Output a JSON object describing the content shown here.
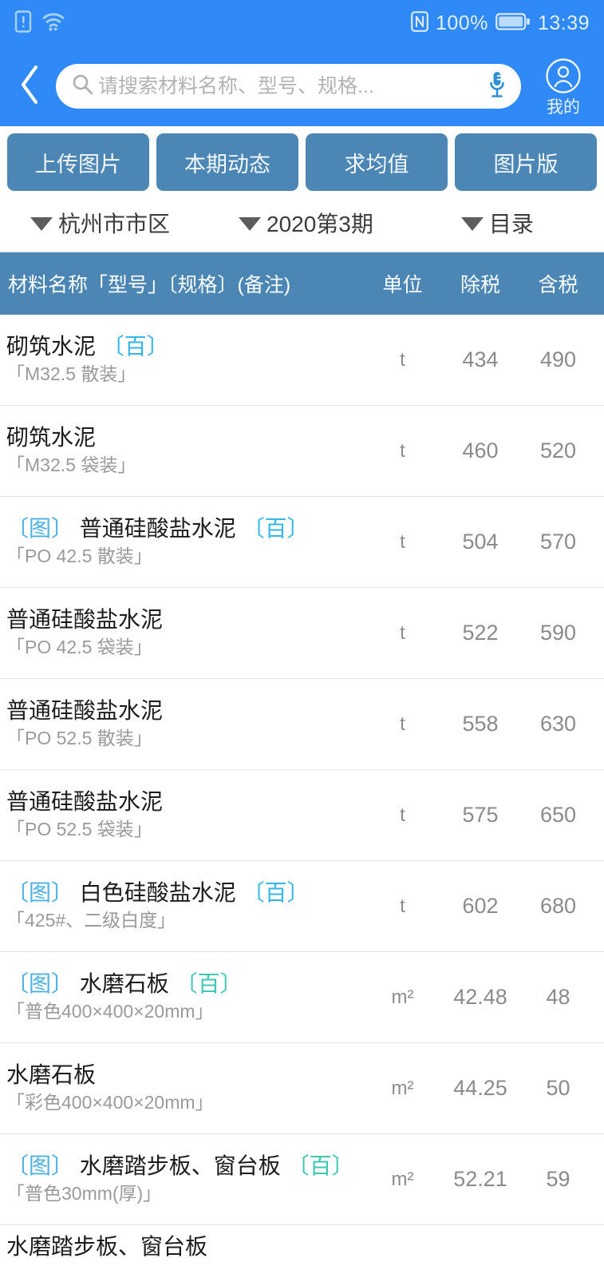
{
  "status_bar": {
    "icons_left": [
      "sim-alert-icon",
      "wifi-icon"
    ],
    "nfc_icon": "nfc-icon",
    "battery_percent": "100%",
    "battery_icon": "battery-full-icon",
    "time": "13:39"
  },
  "header": {
    "back_icon": "back-chevron-icon",
    "search": {
      "icon": "search-icon",
      "placeholder": "请搜索材料名称、型号、规格...",
      "value": "",
      "mic_icon": "microphone-icon"
    },
    "profile": {
      "icon": "user-avatar-icon",
      "label": "我的"
    },
    "bg_color": "#2f89f7"
  },
  "toolbar": {
    "bg_color": "#4b86b4",
    "buttons": [
      {
        "label": "上传图片",
        "name": "upload-image-button"
      },
      {
        "label": "本期动态",
        "name": "current-period-trends-button"
      },
      {
        "label": "求均值",
        "name": "average-value-button"
      },
      {
        "label": "图片版",
        "name": "image-version-button"
      }
    ]
  },
  "filters": [
    {
      "label": "杭州市市区",
      "name": "filter-region"
    },
    {
      "label": "2020第3期",
      "name": "filter-period"
    },
    {
      "label": "目录",
      "name": "filter-catalog"
    }
  ],
  "table": {
    "header_bg": "#4b86b4",
    "columns": {
      "name": "材料名称「型号」〔规格〕(备注)",
      "unit": "单位",
      "ex_tax": "除税",
      "in_tax": "含税"
    },
    "rows": [
      {
        "img_tag": "",
        "name": "砌筑水泥",
        "bai_tag": "〔百〕",
        "bai_color": "blue",
        "spec": "「M32.5 散装」",
        "unit": "t",
        "ex_tax": "434",
        "in_tax": "490"
      },
      {
        "img_tag": "",
        "name": "砌筑水泥",
        "bai_tag": "",
        "bai_color": "",
        "spec": "「M32.5 袋装」",
        "unit": "t",
        "ex_tax": "460",
        "in_tax": "520"
      },
      {
        "img_tag": "〔图〕",
        "name": "普通硅酸盐水泥",
        "bai_tag": "〔百〕",
        "bai_color": "blue",
        "spec": "「PO 42.5 散装」",
        "unit": "t",
        "ex_tax": "504",
        "in_tax": "570"
      },
      {
        "img_tag": "",
        "name": "普通硅酸盐水泥",
        "bai_tag": "",
        "bai_color": "",
        "spec": "「PO 42.5 袋装」",
        "unit": "t",
        "ex_tax": "522",
        "in_tax": "590"
      },
      {
        "img_tag": "",
        "name": "普通硅酸盐水泥",
        "bai_tag": "",
        "bai_color": "",
        "spec": "「PO 52.5 散装」",
        "unit": "t",
        "ex_tax": "558",
        "in_tax": "630"
      },
      {
        "img_tag": "",
        "name": "普通硅酸盐水泥",
        "bai_tag": "",
        "bai_color": "",
        "spec": "「PO 52.5 袋装」",
        "unit": "t",
        "ex_tax": "575",
        "in_tax": "650"
      },
      {
        "img_tag": "〔图〕",
        "name": "白色硅酸盐水泥",
        "bai_tag": "〔百〕",
        "bai_color": "blue",
        "spec": "「425#、二级白度」",
        "unit": "t",
        "ex_tax": "602",
        "in_tax": "680"
      },
      {
        "img_tag": "〔图〕",
        "name": "水磨石板",
        "bai_tag": "〔百〕",
        "bai_color": "teal",
        "spec": "「普色400×400×20mm」",
        "unit": "m²",
        "ex_tax": "42.48",
        "in_tax": "48"
      },
      {
        "img_tag": "",
        "name": "水磨石板",
        "bai_tag": "",
        "bai_color": "",
        "spec": "「彩色400×400×20mm」",
        "unit": "m²",
        "ex_tax": "44.25",
        "in_tax": "50"
      },
      {
        "img_tag": "〔图〕",
        "name": "水磨踏步板、窗台板",
        "bai_tag": "〔百〕",
        "bai_color": "teal",
        "spec": "「普色30mm(厚)」",
        "unit": "m²",
        "ex_tax": "52.21",
        "in_tax": "59"
      }
    ],
    "partial_row": {
      "name": "水磨踏步板、窗台板"
    }
  }
}
